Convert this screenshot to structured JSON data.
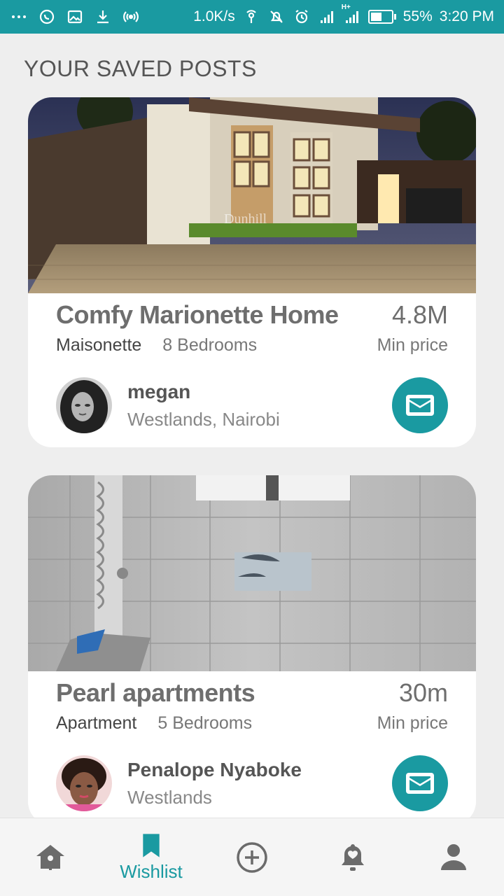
{
  "status_bar": {
    "left_icons": [
      "more-dots-icon",
      "whatsapp-icon",
      "image-icon",
      "download-icon",
      "hotspot-icon"
    ],
    "speed": "1.0K/s",
    "network_label": "H+",
    "battery_percent": "55%",
    "battery_level": 0.55,
    "time": "3:20 PM"
  },
  "page": {
    "title": "YOUR SAVED POSTS"
  },
  "posts": [
    {
      "title": "Comfy Marionette Home",
      "price": "4.8M",
      "price_caption": "Min price",
      "type": "Maisonette",
      "bedrooms": "8 Bedrooms",
      "poster_name": "megan",
      "poster_location": "Westlands, Nairobi",
      "photo_watermark": "Dunhill"
    },
    {
      "title": "Pearl apartments",
      "price": "30m",
      "price_caption": "Min price",
      "type": "Apartment",
      "bedrooms": "5 Bedrooms",
      "poster_name": "Penalope Nyaboke",
      "poster_location": "Westlands"
    }
  ],
  "nav": {
    "items": [
      "home-icon",
      "wishlist-icon",
      "add-icon",
      "notifications-icon",
      "profile-icon"
    ],
    "active_label": "Wishlist"
  },
  "colors": {
    "accent": "#1a9aa1",
    "background": "#eeeeee",
    "card": "#ffffff"
  }
}
